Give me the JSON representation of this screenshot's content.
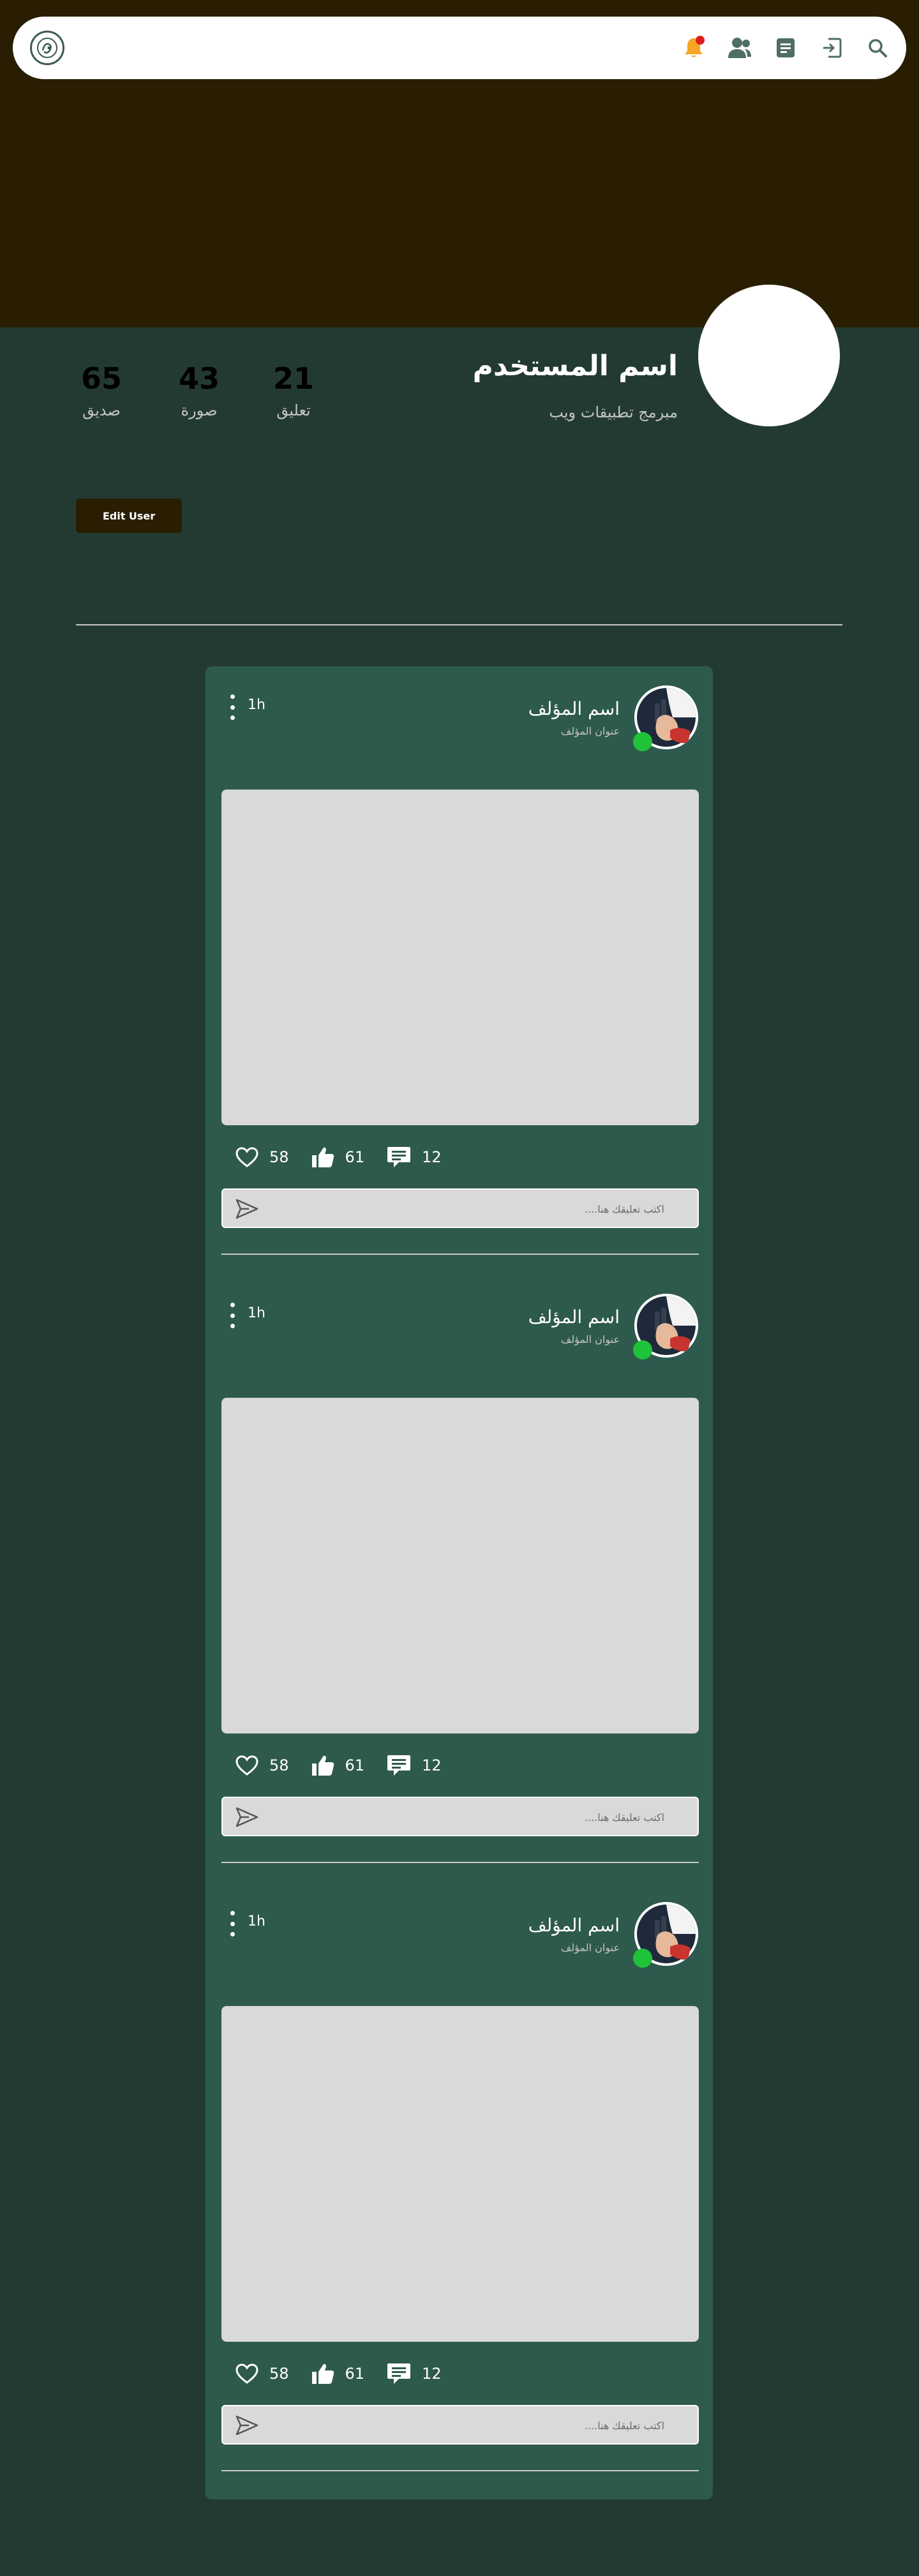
{
  "navbar": {
    "logo_icon": "brand-logo-icon",
    "icons": [
      "notification-bell-icon",
      "friends-icon",
      "document-icon",
      "logout-icon",
      "search-icon"
    ],
    "colors": {
      "background": "#ffffff",
      "icon": "#4f6e64",
      "notification": "#f5a623",
      "notification_dot": "#e01b1b"
    }
  },
  "profile": {
    "username": "اسم المستخدم",
    "title": "مبرمج تطبيقات ويب",
    "stats": [
      {
        "value": "21",
        "label": "تعليق"
      },
      {
        "value": "43",
        "label": "صورة"
      },
      {
        "value": "65",
        "label": "صديق"
      }
    ],
    "edit_button": "Edit User"
  },
  "colors": {
    "page_background": "#233a33",
    "cover_background": "#291e02",
    "feed_background": "#2e5a4d",
    "image_placeholder": "#d9d9d9",
    "online": "#20c23a"
  },
  "posts": [
    {
      "time": "1h",
      "author_name": "اسم المؤلف",
      "author_title": "عنوان المؤلف",
      "likes": "58",
      "thumbs": "61",
      "comments": "12",
      "comment_placeholder": "اكتب تعليقك هنا....",
      "online": true
    },
    {
      "time": "1h",
      "author_name": "اسم المؤلف",
      "author_title": "عنوان المؤلف",
      "likes": "58",
      "thumbs": "61",
      "comments": "12",
      "comment_placeholder": "اكتب تعليقك هنا....",
      "online": true
    },
    {
      "time": "1h",
      "author_name": "اسم المؤلف",
      "author_title": "عنوان المؤلف",
      "likes": "58",
      "thumbs": "61",
      "comments": "12",
      "comment_placeholder": "اكتب تعليقك هنا....",
      "online": true
    }
  ]
}
